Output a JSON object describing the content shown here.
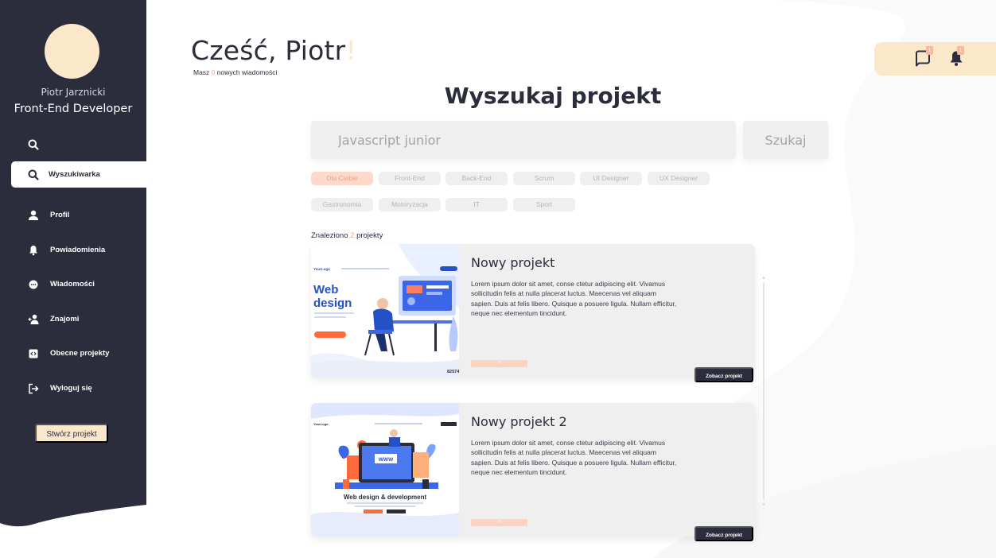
{
  "user": {
    "name": "Piotr Jarznicki",
    "role": "Front-End Developer"
  },
  "sidebar": {
    "items": [
      {
        "label": "Wyszukiwarka",
        "icon": "search-icon",
        "active": true
      },
      {
        "label": "Profil",
        "icon": "user-icon"
      },
      {
        "label": "Powiadomienia",
        "icon": "bell-icon"
      },
      {
        "label": "Wiadomości",
        "icon": "chat-icon"
      },
      {
        "label": "Znajomi",
        "icon": "friends-icon"
      },
      {
        "label": "Obecne projekty",
        "icon": "code-icon"
      },
      {
        "label": "Wyloguj się",
        "icon": "logout-icon"
      }
    ],
    "create_button": "Stwórz projekt"
  },
  "header": {
    "greeting": "Cześć, Piotr",
    "greeting_mark": "!",
    "messages_prefix": "Masz",
    "messages_count": "0",
    "messages_suffix": "nowych wiadomości",
    "message_badge": "1",
    "notification_badge": "1"
  },
  "search": {
    "title": "Wyszukaj projekt",
    "placeholder": "Javascript junior",
    "button": "Szukaj"
  },
  "filters": [
    "Dla Ciebie",
    "Front-End",
    "Back-End",
    "Scrum",
    "UI Designer",
    "UX Designer",
    "Gastronomia",
    "Motoryzacja",
    "IT",
    "Sport"
  ],
  "results": {
    "prefix": "Znaleziono",
    "count": "2",
    "suffix": "projekty"
  },
  "projects": [
    {
      "title": "Nowy projekt",
      "description": "Lorem ipsum dolor sit amet, conse ctetur adipiscing elit. Vivamus sollicitudin felis at nulla placerat luctus. Maecenas vel aliquam sapien. Duis at felis libero. Quisque a posuere ligula. Nullam efficitur, neque nec elementum tincidunt.",
      "tag": "IT",
      "button": "Zobacz projekt",
      "thumb_logo": "YourLogo",
      "thumb_heading_1": "Web",
      "thumb_heading_2": "design",
      "thumb_code": "82574"
    },
    {
      "title": "Nowy projekt 2",
      "description": "Lorem ipsum dolor sit amet, conse ctetur adipiscing elit. Vivamus sollicitudin felis at nulla placerat luctus. Maecenas vel aliquam sapien. Duis at felis libero. Quisque a posuere ligula. Nullam efficitur, neque nec elementum tincidunt.",
      "tag": "IT",
      "button": "Zobacz projekt",
      "thumb_logo": "YourLogo",
      "thumb_heading": "Web design & development",
      "thumb_screen": "WWW"
    }
  ],
  "colors": {
    "sidebar": "#2b2c3c",
    "accent": "#fbe8cb",
    "chip_active": "#fdd9cb",
    "highlight": "#f5a58a"
  }
}
